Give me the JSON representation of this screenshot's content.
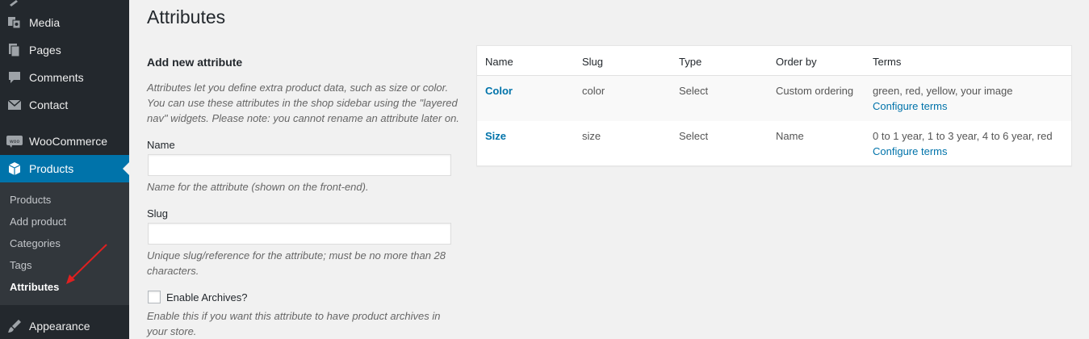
{
  "sidebar": {
    "menu": [
      {
        "label": "Media",
        "icon": "media-icon"
      },
      {
        "label": "Pages",
        "icon": "pages-icon"
      },
      {
        "label": "Comments",
        "icon": "comments-icon"
      },
      {
        "label": "Contact",
        "icon": "contact-icon"
      },
      {
        "label": "WooCommerce",
        "icon": "woocommerce-icon"
      },
      {
        "label": "Products",
        "icon": "products-icon",
        "active": true
      },
      {
        "label": "Appearance",
        "icon": "appearance-icon"
      }
    ],
    "submenu": [
      {
        "label": "Products"
      },
      {
        "label": "Add product"
      },
      {
        "label": "Categories"
      },
      {
        "label": "Tags"
      },
      {
        "label": "Attributes",
        "current": true
      }
    ]
  },
  "page": {
    "title": "Attributes"
  },
  "form": {
    "heading": "Add new attribute",
    "intro": "Attributes let you define extra product data, such as size or color. You can use these attributes in the shop sidebar using the \"layered nav\" widgets. Please note: you cannot rename an attribute later on.",
    "name_label": "Name",
    "name_value": "",
    "name_desc": "Name for the attribute (shown on the front-end).",
    "slug_label": "Slug",
    "slug_value": "",
    "slug_desc": "Unique slug/reference for the attribute; must be no more than 28 characters.",
    "archives_label": "Enable Archives?",
    "archives_checked": false,
    "archives_desc": "Enable this if you want this attribute to have product archives in your store."
  },
  "table": {
    "headers": [
      "Name",
      "Slug",
      "Type",
      "Order by",
      "Terms"
    ],
    "rows": [
      {
        "name": "Color",
        "slug": "color",
        "type": "Select",
        "order_by": "Custom ordering",
        "terms": "green, red, yellow, your image",
        "configure": "Configure terms"
      },
      {
        "name": "Size",
        "slug": "size",
        "type": "Select",
        "order_by": "Name",
        "terms": "0 to 1 year, 1 to 3 year, 4 to 6 year, red",
        "configure": "Configure terms"
      }
    ]
  },
  "colors": {
    "sidebar_bg": "#23282d",
    "submenu_bg": "#32373c",
    "accent": "#0073aa",
    "annotation": "#e02020"
  }
}
